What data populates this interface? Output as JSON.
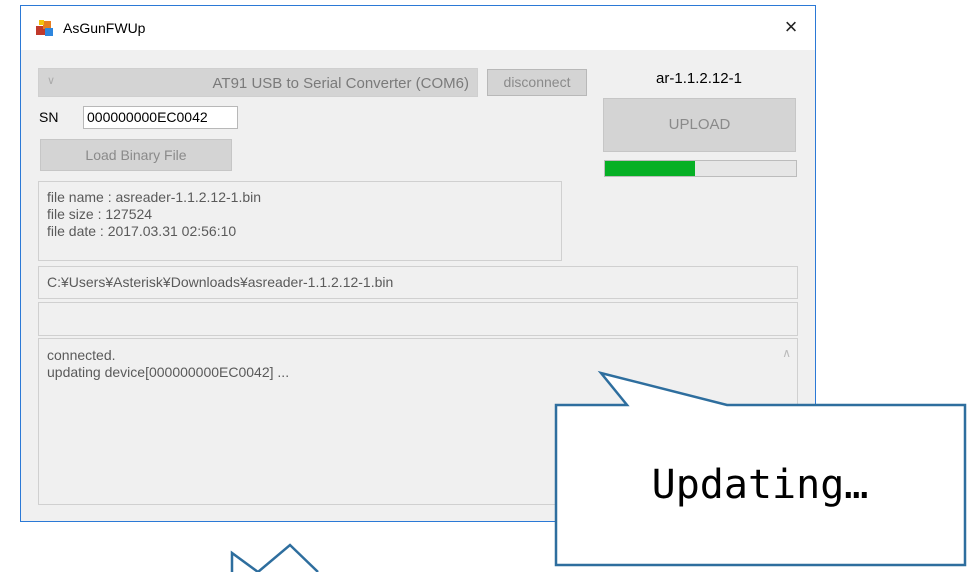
{
  "window": {
    "title": "AsGunFWUp",
    "close_glyph": "×",
    "icon": "app-icon"
  },
  "device": {
    "port_selected": "AT91 USB to Serial Converter (COM6)",
    "disconnect_label": "disconnect",
    "version": "ar-1.1.2.12-1",
    "upload_label": "UPLOAD",
    "progress": 0.47,
    "progress_color": "#06b025"
  },
  "serial": {
    "label": "SN",
    "value": "000000000EC0042"
  },
  "load_button_label": "Load Binary File",
  "file_info": {
    "name": "file name : asreader-1.1.2.12-1.bin",
    "size": "file size : 127524",
    "date": "file date : 2017.03.31 02:56:10"
  },
  "path": "C:¥Users¥Asterisk¥Downloads¥asreader-1.1.2.12-1.bin",
  "status": "",
  "log": [
    "connected.",
    "updating device[000000000EC0042] ..."
  ],
  "callout": {
    "text": "Updating…"
  }
}
